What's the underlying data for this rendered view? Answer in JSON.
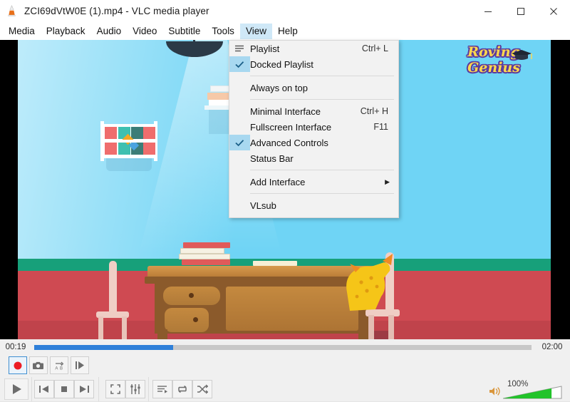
{
  "window": {
    "title": "ZCI69dVtW0E (1).mp4 - VLC media player",
    "app_icon": "vlc-cone-icon",
    "minimize_label": "—",
    "maximize_label": "☐",
    "close_label": "✕"
  },
  "menubar": {
    "items": [
      {
        "label": "Media",
        "active": false
      },
      {
        "label": "Playback",
        "active": false
      },
      {
        "label": "Audio",
        "active": false
      },
      {
        "label": "Video",
        "active": false
      },
      {
        "label": "Subtitle",
        "active": false
      },
      {
        "label": "Tools",
        "active": false
      },
      {
        "label": "View",
        "active": true
      },
      {
        "label": "Help",
        "active": false
      }
    ]
  },
  "view_menu": {
    "items": [
      {
        "label": "Playlist",
        "shortcut": "Ctrl+ L",
        "checked": false,
        "icon": "playlist-icon"
      },
      {
        "label": "Docked Playlist",
        "shortcut": "",
        "checked": true,
        "icon": ""
      },
      {
        "label": "Always on top",
        "shortcut": "",
        "checked": false,
        "icon": ""
      },
      {
        "label": "Minimal Interface",
        "shortcut": "Ctrl+ H",
        "checked": false,
        "icon": ""
      },
      {
        "label": "Fullscreen Interface",
        "shortcut": "F11",
        "checked": false,
        "icon": ""
      },
      {
        "label": "Advanced Controls",
        "shortcut": "",
        "checked": true,
        "icon": ""
      },
      {
        "label": "Status Bar",
        "shortcut": "",
        "checked": false,
        "icon": ""
      },
      {
        "label": "Add Interface",
        "shortcut": "",
        "checked": false,
        "icon": "submenu-arrow-icon"
      },
      {
        "label": "VLsub",
        "shortcut": "",
        "checked": false,
        "icon": ""
      }
    ],
    "submenu_arrow": "▶"
  },
  "video": {
    "logo_line1": "Roving",
    "logo_line2": "Genius",
    "scene_description": "classroom with desk, books, chairs and a yellow dinosaur"
  },
  "playback": {
    "elapsed": "00:19",
    "total": "02:00",
    "progress_percent": 28,
    "fill_color": "#2f80d9"
  },
  "advanced_controls": [
    {
      "name": "record-button",
      "label": "●",
      "selected": true
    },
    {
      "name": "snapshot-button",
      "label": "",
      "selected": false
    },
    {
      "name": "ab-loop-button",
      "label": "",
      "selected": false
    },
    {
      "name": "frame-by-frame-button",
      "label": "",
      "selected": false
    }
  ],
  "main_controls": [
    {
      "name": "play-button",
      "label": "▶"
    },
    {
      "name": "previous-button",
      "label": "⏮"
    },
    {
      "name": "stop-button",
      "label": "■"
    },
    {
      "name": "next-button",
      "label": "⏭"
    },
    {
      "name": "fullscreen-button",
      "label": ""
    },
    {
      "name": "extended-settings-button",
      "label": ""
    },
    {
      "name": "playlist-button",
      "label": ""
    },
    {
      "name": "loop-button",
      "label": ""
    },
    {
      "name": "random-button",
      "label": ""
    }
  ],
  "volume": {
    "percent_label": "100%",
    "level": 100,
    "mute_icon": "speaker-icon",
    "bar_color": "#22c32a"
  }
}
